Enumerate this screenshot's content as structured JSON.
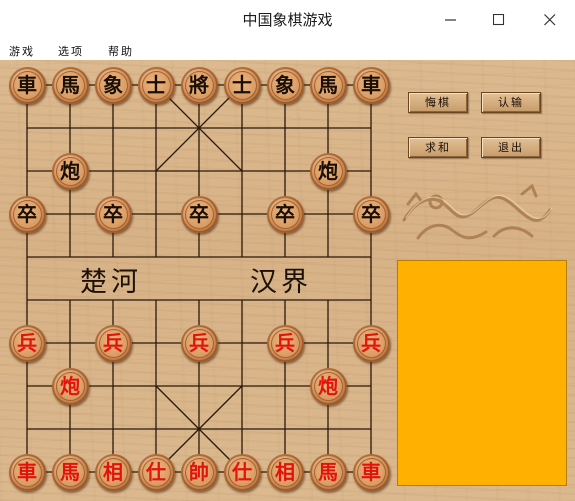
{
  "window": {
    "title": "中国象棋游戏",
    "controls": [
      {
        "name": "minimize-button",
        "icon": "minimize-icon"
      },
      {
        "name": "maximize-button",
        "icon": "maximize-icon"
      },
      {
        "name": "close-button",
        "icon": "close-icon"
      }
    ]
  },
  "menu": {
    "items": [
      {
        "key": "game",
        "label": "游戏"
      },
      {
        "key": "options",
        "label": "选项"
      },
      {
        "key": "help",
        "label": "帮助"
      }
    ]
  },
  "board": {
    "river_left": "楚河",
    "river_right": "汉界",
    "pieces": [
      {
        "char": "車",
        "side": "black",
        "file": 0,
        "rank": 0
      },
      {
        "char": "馬",
        "side": "black",
        "file": 1,
        "rank": 0
      },
      {
        "char": "象",
        "side": "black",
        "file": 2,
        "rank": 0
      },
      {
        "char": "士",
        "side": "black",
        "file": 3,
        "rank": 0
      },
      {
        "char": "將",
        "side": "black",
        "file": 4,
        "rank": 0
      },
      {
        "char": "士",
        "side": "black",
        "file": 5,
        "rank": 0
      },
      {
        "char": "象",
        "side": "black",
        "file": 6,
        "rank": 0
      },
      {
        "char": "馬",
        "side": "black",
        "file": 7,
        "rank": 0
      },
      {
        "char": "車",
        "side": "black",
        "file": 8,
        "rank": 0
      },
      {
        "char": "炮",
        "side": "black",
        "file": 1,
        "rank": 2
      },
      {
        "char": "炮",
        "side": "black",
        "file": 7,
        "rank": 2
      },
      {
        "char": "卒",
        "side": "black",
        "file": 0,
        "rank": 3
      },
      {
        "char": "卒",
        "side": "black",
        "file": 2,
        "rank": 3
      },
      {
        "char": "卒",
        "side": "black",
        "file": 4,
        "rank": 3
      },
      {
        "char": "卒",
        "side": "black",
        "file": 6,
        "rank": 3
      },
      {
        "char": "卒",
        "side": "black",
        "file": 8,
        "rank": 3
      },
      {
        "char": "兵",
        "side": "red",
        "file": 0,
        "rank": 6
      },
      {
        "char": "兵",
        "side": "red",
        "file": 2,
        "rank": 6
      },
      {
        "char": "兵",
        "side": "red",
        "file": 4,
        "rank": 6
      },
      {
        "char": "兵",
        "side": "red",
        "file": 6,
        "rank": 6
      },
      {
        "char": "兵",
        "side": "red",
        "file": 8,
        "rank": 6
      },
      {
        "char": "炮",
        "side": "red",
        "file": 1,
        "rank": 7
      },
      {
        "char": "炮",
        "side": "red",
        "file": 7,
        "rank": 7
      },
      {
        "char": "車",
        "side": "red",
        "file": 0,
        "rank": 9
      },
      {
        "char": "馬",
        "side": "red",
        "file": 1,
        "rank": 9
      },
      {
        "char": "相",
        "side": "red",
        "file": 2,
        "rank": 9
      },
      {
        "char": "仕",
        "side": "red",
        "file": 3,
        "rank": 9
      },
      {
        "char": "帥",
        "side": "red",
        "file": 4,
        "rank": 9
      },
      {
        "char": "仕",
        "side": "red",
        "file": 5,
        "rank": 9
      },
      {
        "char": "相",
        "side": "red",
        "file": 6,
        "rank": 9
      },
      {
        "char": "馬",
        "side": "red",
        "file": 7,
        "rank": 9
      },
      {
        "char": "車",
        "side": "red",
        "file": 8,
        "rank": 9
      }
    ]
  },
  "buttons": {
    "undo": "悔棋",
    "resign": "认输",
    "draw": "求和",
    "quit": "退出"
  },
  "colors": {
    "board_wood": "#d8b287",
    "black_piece_text": "#1a0f05",
    "red_piece_text": "#e0140c",
    "info_panel": "#ffb000"
  }
}
